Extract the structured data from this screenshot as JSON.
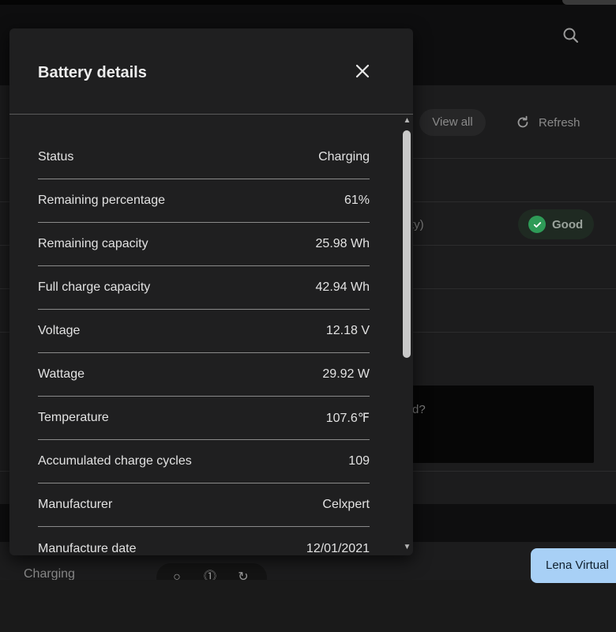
{
  "background": {
    "view_all_label": "View all",
    "refresh_label": "Refresh",
    "partial_ty": "ty)",
    "partial_d": "d?",
    "health_badge": "Good",
    "charging_label": "Charging",
    "assistant_chip": "Lena Virtual"
  },
  "dialog": {
    "title": "Battery details",
    "rows": [
      {
        "label": "Status",
        "value": "Charging"
      },
      {
        "label": "Remaining percentage",
        "value": "61%"
      },
      {
        "label": "Remaining capacity",
        "value": "25.98 Wh"
      },
      {
        "label": "Full charge capacity",
        "value": "42.94 Wh"
      },
      {
        "label": "Voltage",
        "value": "12.18 V"
      },
      {
        "label": "Wattage",
        "value": "29.92 W"
      },
      {
        "label": "Temperature",
        "value": "107.6℉"
      },
      {
        "label": "Accumulated charge cycles",
        "value": "109"
      },
      {
        "label": "Manufacturer",
        "value": "Celxpert"
      },
      {
        "label": "Manufacture date",
        "value": "12/01/2021"
      }
    ]
  },
  "icons": {
    "search": "search-icon",
    "refresh": "refresh-icon",
    "check": "check-circle-icon",
    "close": "close-icon"
  },
  "colors": {
    "good_green": "#2e9b57",
    "chip_blue": "#a8d0f6",
    "dialog_bg": "#1f1f20"
  }
}
